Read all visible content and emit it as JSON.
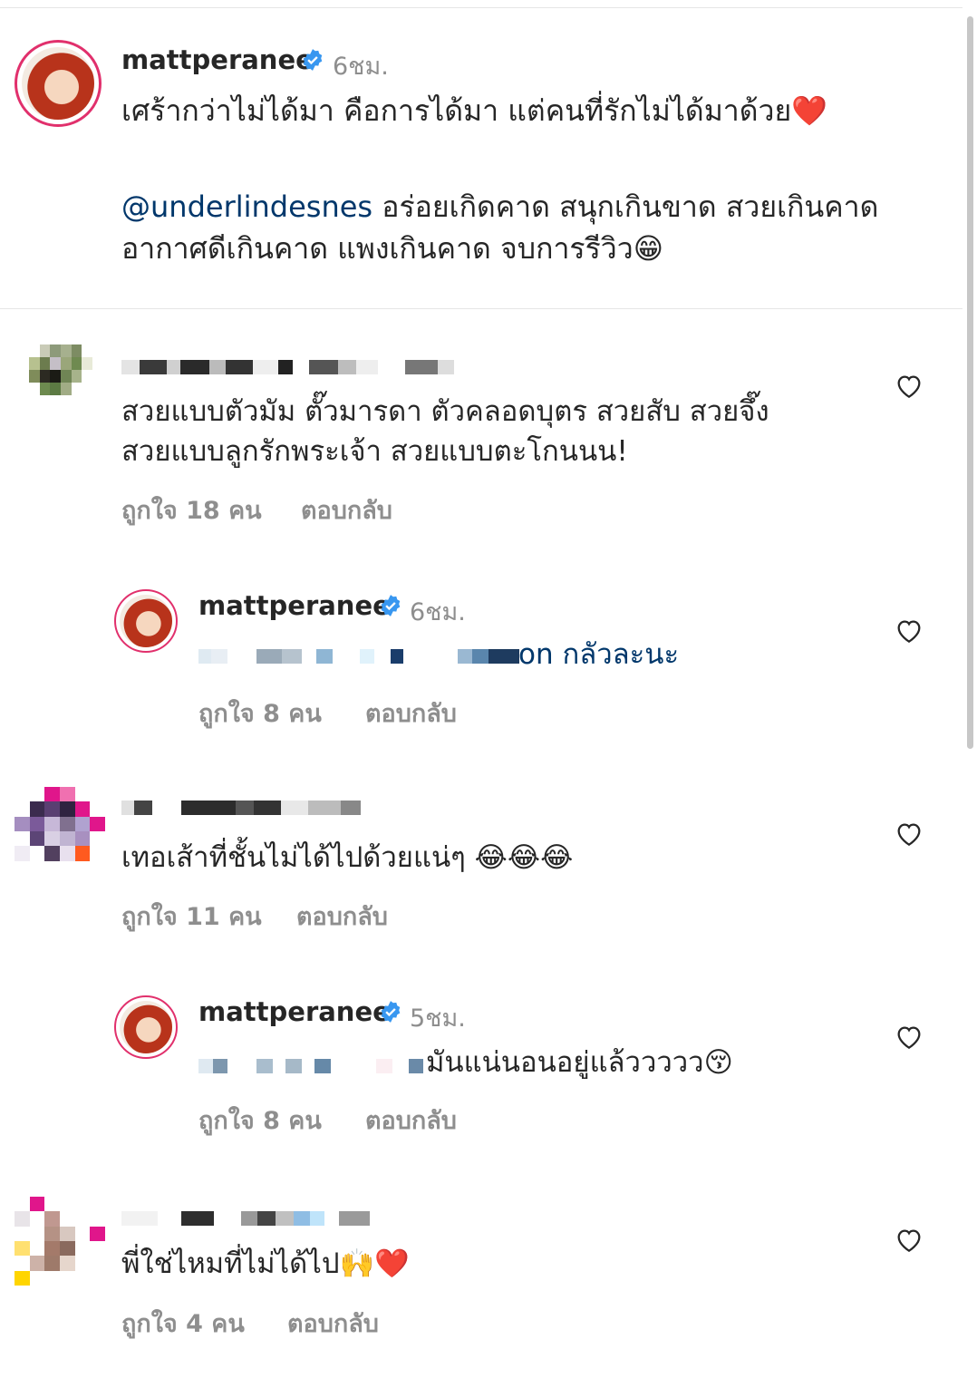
{
  "post": {
    "username": "mattperanee",
    "time": "6ชม.",
    "caption_line1": "เศร้ากว่าไม่ได้มา คือการได้มา แต่คนที่รักไม่ได้มาด้วย❤️",
    "mention": "@underlindesnes",
    "caption_line2": " อร่อยเกิดคาด สนุกเกินขาด สวยเกินคาด",
    "caption_line3": "อากาศดีเกินคาด แพงเกินคาด จบการรีวิว😁"
  },
  "comments": [
    {
      "text_line1": "สวยแบบตัวมัม ตั๊วมารดา ตัวคลอดบุตร สวยสับ สวยจึ๊ง",
      "text_line2": "สวยแบบลูกรักพระเจ้า สวยแบบตะโกนนน!",
      "likes": "ถูกใจ 18 คน",
      "reply": "ตอบกลับ"
    },
    {
      "username": "mattperanee",
      "time": "6ชม.",
      "text": "on กลัวละนะ",
      "likes": "ถูกใจ 8 คน",
      "reply": "ตอบกลับ"
    },
    {
      "text_line1": "เทอเส้าที่ชั้นไม่ได้ไปด้วยแน่ๆ 😂😂😂",
      "likes": "ถูกใจ 11 คน",
      "reply": "ตอบกลับ"
    },
    {
      "username": "mattperanee",
      "time": "5ชม.",
      "text": "มันแน่นอนอยู่แล้ววววว😚",
      "likes": "ถูกใจ 8 คน",
      "reply": "ตอบกลับ"
    },
    {
      "text_line1": "พี่ใช่ไหมที่ไม่ได้ไป🙌❤️",
      "likes": "ถูกใจ 4 คน",
      "reply": "ตอบกลับ"
    }
  ],
  "icons": {
    "verified": "verified-badge-icon",
    "like": "heart-outline-icon"
  },
  "colors": {
    "mention": "#00376b",
    "verified": "#3897f0",
    "muted": "#8e8e8e"
  }
}
